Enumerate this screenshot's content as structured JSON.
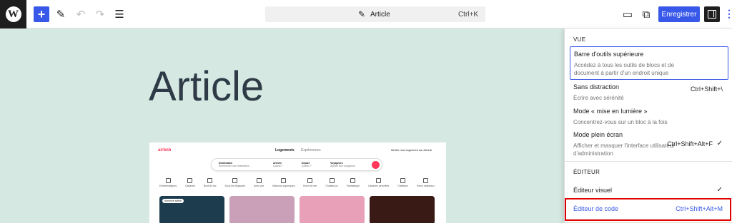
{
  "toolbar": {
    "logo_glyph": "W",
    "add_glyph": "+",
    "tools_glyph": "✎",
    "undo_glyph": "↶",
    "redo_glyph": "↷",
    "outline_glyph": "☰",
    "command_icon": "✎",
    "command_title": "Article",
    "command_shortcut": "Ctrl+K",
    "view_glyph": "▭",
    "external_glyph": "⧉",
    "save_label": "Enregistrer",
    "more_glyph": "⋮"
  },
  "canvas": {
    "title": "Article",
    "background": "#d5e8e1"
  },
  "embed": {
    "logo": "airbnb",
    "tabs": [
      "Logements",
      "Expériences"
    ],
    "host_text": "Mettre mon logement sur Airbnb",
    "search": [
      {
        "label": "Destination",
        "hint": "Rechercher une destination"
      },
      {
        "label": "Arrivée",
        "hint": "Quand ?"
      },
      {
        "label": "Départ",
        "hint": "Quand ?"
      },
      {
        "label": "Voyageurs",
        "hint": "Ajouter des voyageurs"
      }
    ],
    "categories": [
      "Emblématiques",
      "Cabanes",
      "Bord de lac",
      "Sous les tropiques",
      "Avec vue",
      "Maisons organiques",
      "Bord de mer",
      "Chalets-lux",
      "Fantastique",
      "Cabanes perchées",
      "Châteaux",
      "Parcs nationaux"
    ],
    "badge": "Annonce active",
    "card_colors": [
      "#1d3d4f",
      "#c9a0b8",
      "#e8a0b8",
      "#3a1a14"
    ]
  },
  "menu": {
    "view_heading": "VUE",
    "items": [
      {
        "label": "Barre d'outils supérieure",
        "desc": "Accédez à tous les outils de blocs et de document à partir d'un endroit unique",
        "shortcut": ""
      },
      {
        "label": "Sans distraction",
        "desc": "Écrire avec sérénité",
        "shortcut": "Ctrl+Shift+\\"
      },
      {
        "label": "Mode « mise en lumière »",
        "desc": "Concentrez-vous sur un bloc à la fois",
        "shortcut": ""
      },
      {
        "label": "Mode plein écran",
        "desc": "Afficher et masquer l'interface utilisateur d'administration",
        "shortcut": "Ctrl+Shift+Alt+F",
        "check": "✓"
      }
    ],
    "editor_heading": "ÉDITEUR",
    "editor_items": [
      {
        "label": "Éditeur visuel",
        "check": "✓"
      },
      {
        "label": "Éditeur de code",
        "shortcut": "Ctrl+Shift+Alt+M"
      }
    ]
  }
}
